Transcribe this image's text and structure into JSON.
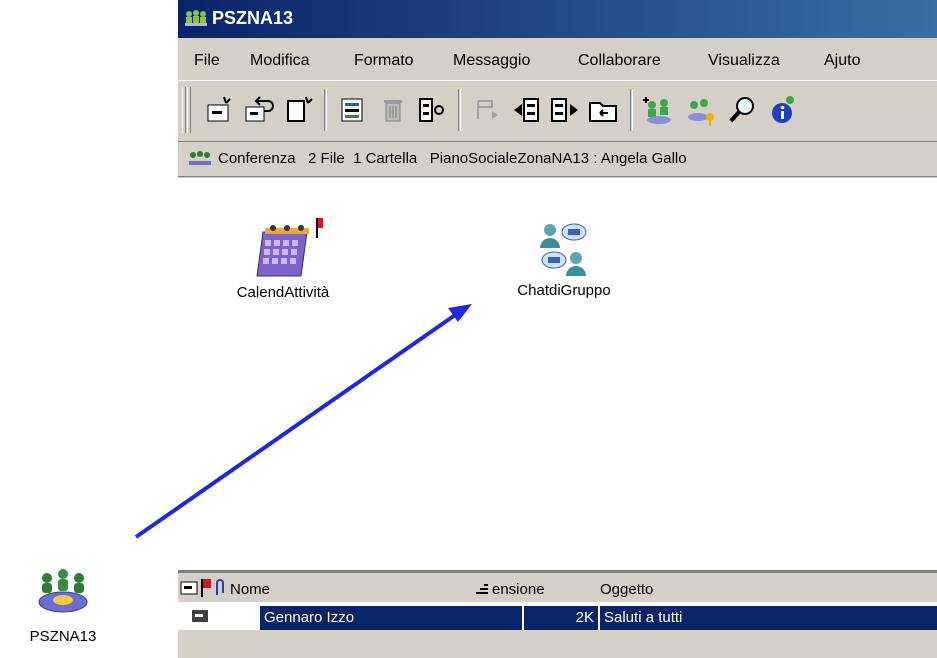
{
  "desktop": {
    "icon_label": "PSZNA13"
  },
  "window": {
    "title": "PSZNA13"
  },
  "menu": [
    "File",
    "Modifica",
    "Formato",
    "Messaggio",
    "Collaborare",
    "Visualizza",
    "Ajuto"
  ],
  "toolbar": {
    "icons": [
      "new-document-icon",
      "reply-icon",
      "copy-icon",
      "form-icon",
      "delete-icon",
      "move-icon",
      "forward-icon",
      "back-icon",
      "next-icon",
      "folder-icon",
      "add-member-icon",
      "key-icon",
      "search-icon",
      "info-icon"
    ]
  },
  "infobar": {
    "text": "Conferenza   2 File  1 Cartella   PianoSocialeZonaNA13 : Angela Gallo"
  },
  "files": [
    {
      "label": "CalendAttività",
      "icon": "calendar-icon",
      "flag": true
    },
    {
      "label": "ChatdiGruppo",
      "icon": "group-chat-icon",
      "flag": false
    }
  ],
  "list": {
    "columns": [
      "Nome",
      "ensione",
      "Oggetto"
    ],
    "rows": [
      {
        "name": "Gennaro Izzo",
        "size": "2K",
        "subject": "Saluti a tutti"
      }
    ]
  },
  "colors": {
    "title_bar": "#0a246a",
    "selection": "#0a246a",
    "arrow": "#1e28e0",
    "flag": "#e0101a"
  }
}
